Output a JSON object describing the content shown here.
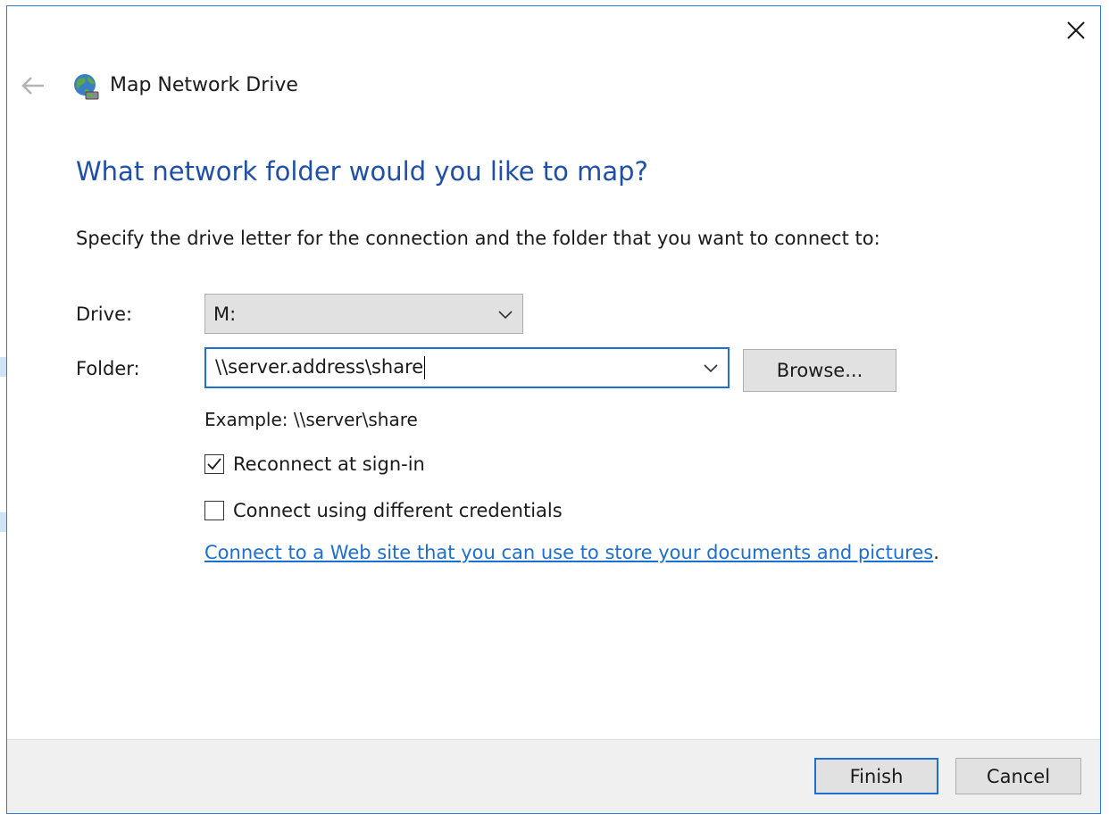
{
  "window": {
    "title": "Map Network Drive",
    "close_icon": "close-icon",
    "back_icon": "back-arrow-icon",
    "app_icon": "network-drive-icon"
  },
  "page": {
    "heading": "What network folder would you like to map?",
    "instruction": "Specify the drive letter for the connection and the folder that you want to connect to:"
  },
  "drive": {
    "label": "Drive:",
    "value": "M:"
  },
  "folder": {
    "label": "Folder:",
    "value": "\\\\server.address\\share",
    "browse_label": "Browse...",
    "example": "Example: \\\\server\\share"
  },
  "options": {
    "reconnect_label": "Reconnect at sign-in",
    "reconnect_checked": true,
    "credentials_label": "Connect using different credentials",
    "credentials_checked": false
  },
  "link": {
    "text": "Connect to a Web site that you can use to store your documents and pictures",
    "suffix": "."
  },
  "footer": {
    "finish_label": "Finish",
    "cancel_label": "Cancel"
  },
  "colors": {
    "accent": "#1f6fd0",
    "heading": "#1f4fa8",
    "link": "#1a6fd0",
    "border": "#2b79d8",
    "footer_bg": "#f0f0f0"
  }
}
